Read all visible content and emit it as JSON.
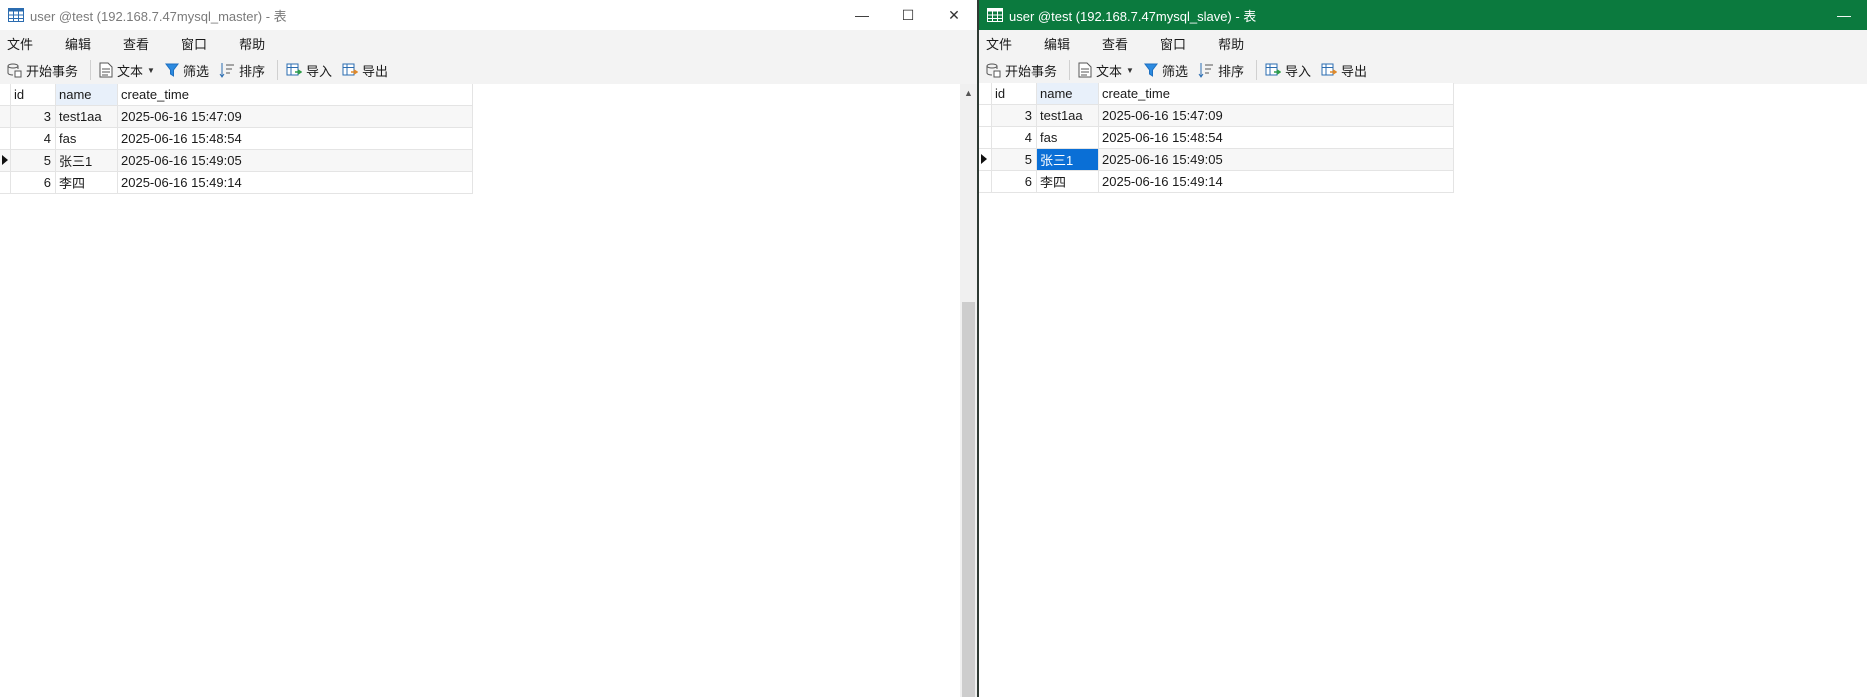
{
  "left": {
    "title": "user @test (192.168.7.47mysql_master) - 表",
    "controls": {
      "minimize": "—",
      "maximize": "☐",
      "close": "✕"
    },
    "menu": [
      "文件",
      "编辑",
      "查看",
      "窗口",
      "帮助"
    ],
    "toolbar": {
      "begin_tx": "开始事务",
      "text": "文本",
      "filter": "筛选",
      "sort": "排序",
      "import": "导入",
      "export": "导出"
    },
    "columns": [
      "id",
      "name",
      "create_time"
    ],
    "rows": [
      {
        "id": "3",
        "name": "test1aa",
        "create_time": "2025-06-16 15:47:09"
      },
      {
        "id": "4",
        "name": "fas",
        "create_time": "2025-06-16 15:48:54"
      },
      {
        "id": "5",
        "name": "张三1",
        "create_time": "2025-06-16 15:49:05"
      },
      {
        "id": "6",
        "name": "李四",
        "create_time": "2025-06-16 15:49:14"
      }
    ]
  },
  "right": {
    "title": "user @test (192.168.7.47mysql_slave) - 表",
    "controls": {
      "minimize": "—"
    },
    "menu": [
      "文件",
      "编辑",
      "查看",
      "窗口",
      "帮助"
    ],
    "toolbar": {
      "begin_tx": "开始事务",
      "text": "文本",
      "filter": "筛选",
      "sort": "排序",
      "import": "导入",
      "export": "导出"
    },
    "columns": [
      "id",
      "name",
      "create_time"
    ],
    "rows": [
      {
        "id": "3",
        "name": "test1aa",
        "create_time": "2025-06-16 15:47:09"
      },
      {
        "id": "4",
        "name": "fas",
        "create_time": "2025-06-16 15:48:54"
      },
      {
        "id": "5",
        "name": "张三1",
        "create_time": "2025-06-16 15:49:05"
      },
      {
        "id": "6",
        "name": "李四",
        "create_time": "2025-06-16 15:49:14"
      }
    ]
  },
  "colors": {
    "right_titlebar": "#0b7a3e",
    "selection": "#0a6fd6",
    "header_highlight": "#e8f0fa"
  }
}
